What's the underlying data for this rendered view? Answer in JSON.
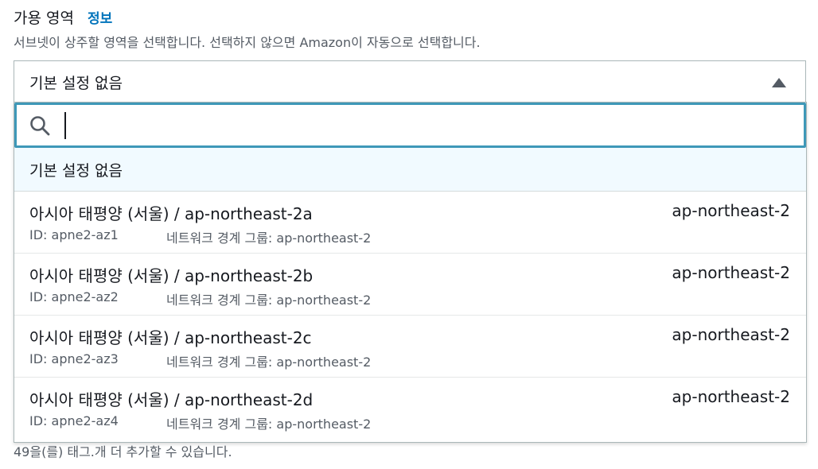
{
  "field": {
    "label": "가용 영역",
    "info_link": "정보",
    "description": "서브넷이 상주할 영역을 선택합니다. 선택하지 않으면 Amazon이 자동으로 선택합니다."
  },
  "select": {
    "value": "기본 설정 없음"
  },
  "search": {
    "value": "",
    "placeholder": ""
  },
  "options": {
    "none_label": "기본 설정 없음",
    "items": [
      {
        "title": "아시아 태평양 (서울) / ap-northeast-2a",
        "region": "ap-northeast-2",
        "id": "ID: apne2-az1",
        "group": "네트워크 경계 그룹: ap-northeast-2"
      },
      {
        "title": "아시아 태평양 (서울) / ap-northeast-2b",
        "region": "ap-northeast-2",
        "id": "ID: apne2-az2",
        "group": "네트워크 경계 그룹: ap-northeast-2"
      },
      {
        "title": "아시아 태평양 (서울) / ap-northeast-2c",
        "region": "ap-northeast-2",
        "id": "ID: apne2-az3",
        "group": "네트워크 경계 그룹: ap-northeast-2"
      },
      {
        "title": "아시아 태평양 (서울) / ap-northeast-2d",
        "region": "ap-northeast-2",
        "id": "ID: apne2-az4",
        "group": "네트워크 경계 그룹: ap-northeast-2"
      }
    ]
  },
  "footer_hint": "49을(를) 태그.개 더 추가할 수 있습니다.",
  "icons": {
    "search": "search-icon",
    "caret": "caret-up-icon"
  },
  "colors": {
    "link": "#0073bb",
    "focus_border": "#3e98b8",
    "highlight": "#f1faff"
  }
}
